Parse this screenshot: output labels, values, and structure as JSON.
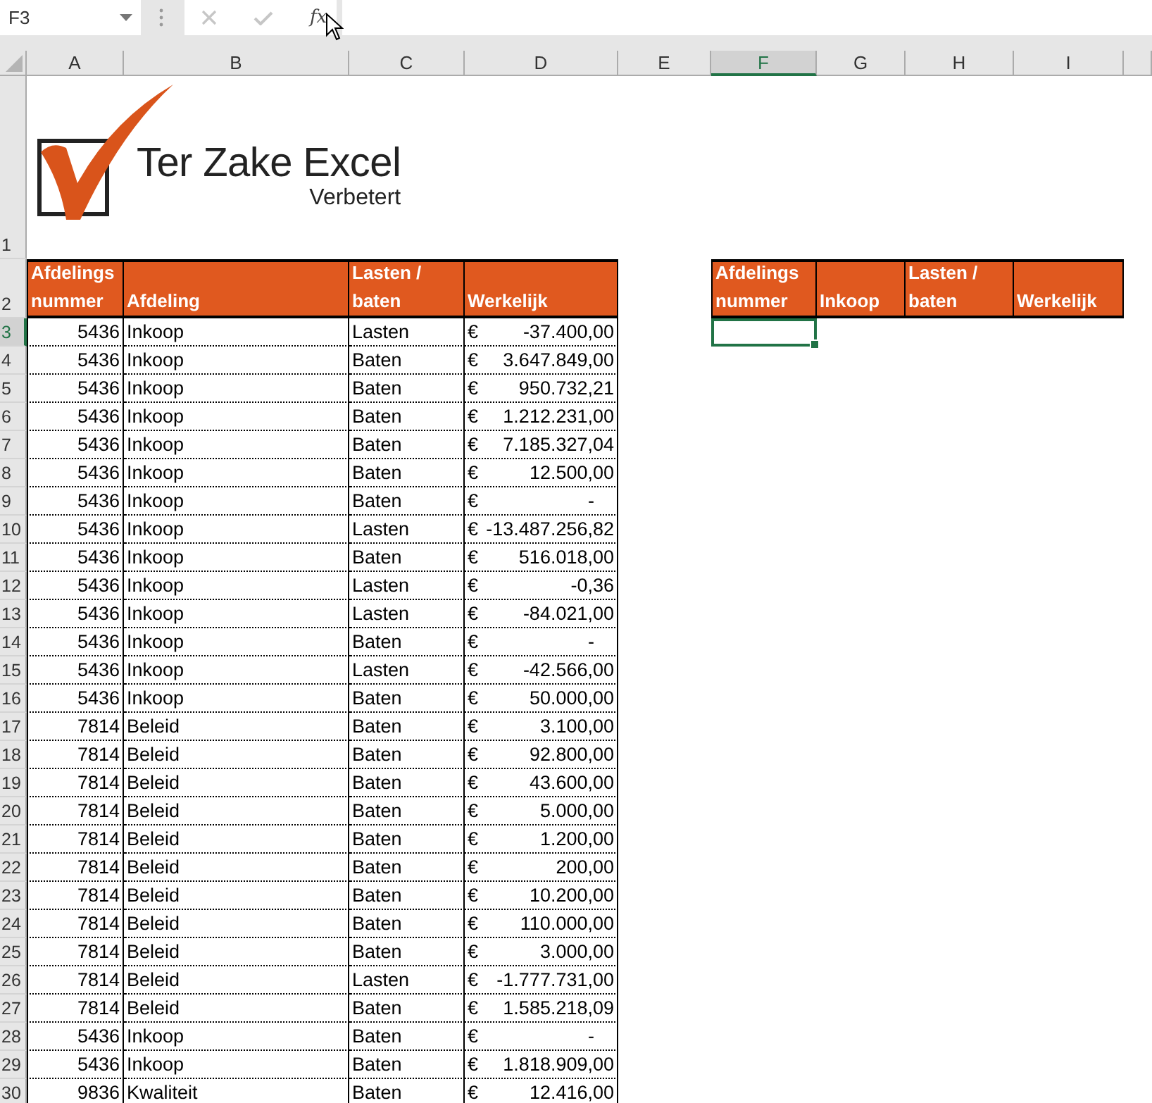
{
  "name_box": {
    "value": "F3"
  },
  "formula_bar": {
    "fx_label": "fx"
  },
  "columns": [
    {
      "label": "A",
      "selected": false
    },
    {
      "label": "B",
      "selected": false
    },
    {
      "label": "C",
      "selected": false
    },
    {
      "label": "D",
      "selected": false
    },
    {
      "label": "E",
      "selected": false
    },
    {
      "label": "F",
      "selected": true
    },
    {
      "label": "G",
      "selected": false
    },
    {
      "label": "H",
      "selected": false
    },
    {
      "label": "I",
      "selected": false
    }
  ],
  "logo": {
    "title": "Ter Zake Excel",
    "subtitle": "Verbetert"
  },
  "header_rows": [
    {
      "row_number": "1",
      "selected": false
    },
    {
      "row_number": "2",
      "selected": false
    }
  ],
  "table": {
    "columns": [
      "Afdelings nummer",
      "Afdeling",
      "Lasten / baten",
      "Werkelijk"
    ],
    "rows": [
      {
        "row_number": "3",
        "selected": true,
        "number": "5436",
        "department": "Inkoop",
        "type": "Lasten",
        "currency": "€",
        "amount": "-37.400,00"
      },
      {
        "row_number": "4",
        "selected": false,
        "number": "5436",
        "department": "Inkoop",
        "type": "Baten",
        "currency": "€",
        "amount": "3.647.849,00"
      },
      {
        "row_number": "5",
        "selected": false,
        "number": "5436",
        "department": "Inkoop",
        "type": "Baten",
        "currency": "€",
        "amount": "950.732,21"
      },
      {
        "row_number": "6",
        "selected": false,
        "number": "5436",
        "department": "Inkoop",
        "type": "Baten",
        "currency": "€",
        "amount": "1.212.231,00"
      },
      {
        "row_number": "7",
        "selected": false,
        "number": "5436",
        "department": "Inkoop",
        "type": "Baten",
        "currency": "€",
        "amount": "7.185.327,04"
      },
      {
        "row_number": "8",
        "selected": false,
        "number": "5436",
        "department": "Inkoop",
        "type": "Baten",
        "currency": "€",
        "amount": "12.500,00"
      },
      {
        "row_number": "9",
        "selected": false,
        "number": "5436",
        "department": "Inkoop",
        "type": "Baten",
        "currency": "€",
        "amount": "-"
      },
      {
        "row_number": "10",
        "selected": false,
        "number": "5436",
        "department": "Inkoop",
        "type": "Lasten",
        "currency": "€",
        "amount": "-13.487.256,82"
      },
      {
        "row_number": "11",
        "selected": false,
        "number": "5436",
        "department": "Inkoop",
        "type": "Baten",
        "currency": "€",
        "amount": "516.018,00"
      },
      {
        "row_number": "12",
        "selected": false,
        "number": "5436",
        "department": "Inkoop",
        "type": "Lasten",
        "currency": "€",
        "amount": "-0,36"
      },
      {
        "row_number": "13",
        "selected": false,
        "number": "5436",
        "department": "Inkoop",
        "type": "Lasten",
        "currency": "€",
        "amount": "-84.021,00"
      },
      {
        "row_number": "14",
        "selected": false,
        "number": "5436",
        "department": "Inkoop",
        "type": "Baten",
        "currency": "€",
        "amount": "-"
      },
      {
        "row_number": "15",
        "selected": false,
        "number": "5436",
        "department": "Inkoop",
        "type": "Lasten",
        "currency": "€",
        "amount": "-42.566,00"
      },
      {
        "row_number": "16",
        "selected": false,
        "number": "5436",
        "department": "Inkoop",
        "type": "Baten",
        "currency": "€",
        "amount": "50.000,00"
      },
      {
        "row_number": "17",
        "selected": false,
        "number": "7814",
        "department": "Beleid",
        "type": "Baten",
        "currency": "€",
        "amount": "3.100,00"
      },
      {
        "row_number": "18",
        "selected": false,
        "number": "7814",
        "department": "Beleid",
        "type": "Baten",
        "currency": "€",
        "amount": "92.800,00"
      },
      {
        "row_number": "19",
        "selected": false,
        "number": "7814",
        "department": "Beleid",
        "type": "Baten",
        "currency": "€",
        "amount": "43.600,00"
      },
      {
        "row_number": "20",
        "selected": false,
        "number": "7814",
        "department": "Beleid",
        "type": "Baten",
        "currency": "€",
        "amount": "5.000,00"
      },
      {
        "row_number": "21",
        "selected": false,
        "number": "7814",
        "department": "Beleid",
        "type": "Baten",
        "currency": "€",
        "amount": "1.200,00"
      },
      {
        "row_number": "22",
        "selected": false,
        "number": "7814",
        "department": "Beleid",
        "type": "Baten",
        "currency": "€",
        "amount": "200,00"
      },
      {
        "row_number": "23",
        "selected": false,
        "number": "7814",
        "department": "Beleid",
        "type": "Baten",
        "currency": "€",
        "amount": "10.200,00"
      },
      {
        "row_number": "24",
        "selected": false,
        "number": "7814",
        "department": "Beleid",
        "type": "Baten",
        "currency": "€",
        "amount": "110.000,00"
      },
      {
        "row_number": "25",
        "selected": false,
        "number": "7814",
        "department": "Beleid",
        "type": "Baten",
        "currency": "€",
        "amount": "3.000,00"
      },
      {
        "row_number": "26",
        "selected": false,
        "number": "7814",
        "department": "Beleid",
        "type": "Lasten",
        "currency": "€",
        "amount": "-1.777.731,00"
      },
      {
        "row_number": "27",
        "selected": false,
        "number": "7814",
        "department": "Beleid",
        "type": "Baten",
        "currency": "€",
        "amount": "1.585.218,09"
      },
      {
        "row_number": "28",
        "selected": false,
        "number": "5436",
        "department": "Inkoop",
        "type": "Baten",
        "currency": "€",
        "amount": "-"
      },
      {
        "row_number": "29",
        "selected": false,
        "number": "5436",
        "department": "Inkoop",
        "type": "Baten",
        "currency": "€",
        "amount": "1.818.909,00"
      },
      {
        "row_number": "30",
        "selected": false,
        "number": "9836",
        "department": "Kwaliteit",
        "type": "Baten",
        "currency": "€",
        "amount": "12.416,00"
      }
    ]
  },
  "summary_table": {
    "columns": [
      "Afdelings nummer",
      "Inkoop",
      "Lasten / baten",
      "Werkelijk"
    ],
    "cells": [
      {
        "selected": true
      }
    ]
  }
}
